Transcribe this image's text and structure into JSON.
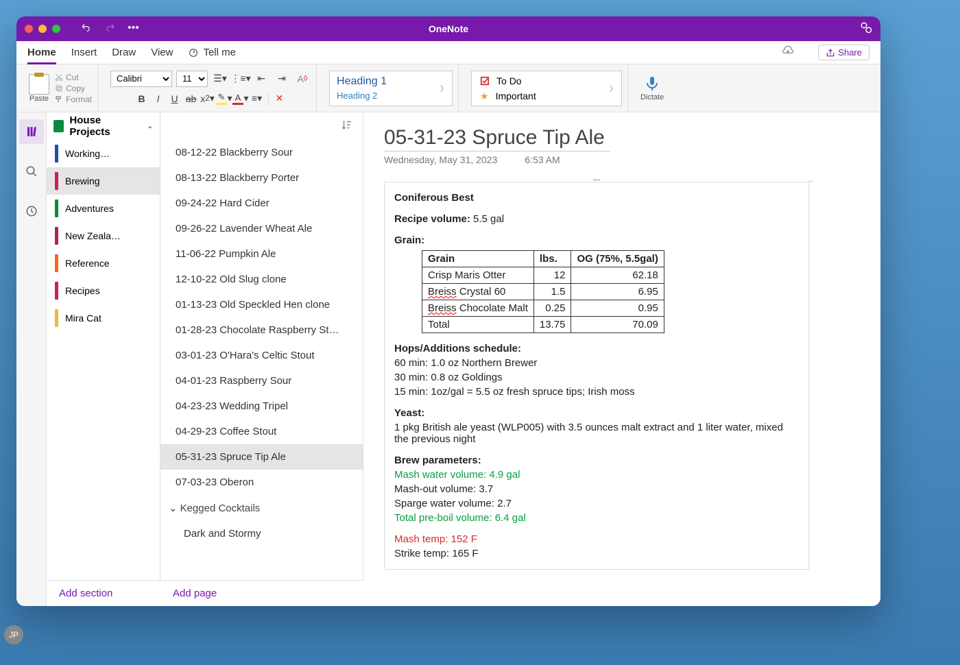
{
  "titlebar": {
    "title": "OneNote"
  },
  "tabs": {
    "home": "Home",
    "insert": "Insert",
    "draw": "Draw",
    "view": "View",
    "tellme": "Tell me",
    "share": "Share"
  },
  "ribbon": {
    "paste": "Paste",
    "cut": "Cut",
    "copy": "Copy",
    "format": "Format",
    "font": "Calibri",
    "size": "11",
    "heading1": "Heading 1",
    "heading2": "Heading 2",
    "todo": "To Do",
    "important": "Important",
    "dictate": "Dictate"
  },
  "notebook": {
    "name": "House Projects"
  },
  "sections": [
    {
      "label": "Working…",
      "color": "#1e4ea0"
    },
    {
      "label": "Brewing",
      "color": "#c81e5b",
      "selected": true
    },
    {
      "label": "Adventures",
      "color": "#0d8a3e"
    },
    {
      "label": "New Zeala…",
      "color": "#b51e4f"
    },
    {
      "label": "Reference",
      "color": "#ee6b1f"
    },
    {
      "label": "Recipes",
      "color": "#c81e5b"
    },
    {
      "label": "Mira Cat",
      "color": "#f0b93a"
    }
  ],
  "pages": [
    {
      "t": "08-12-22 Blackberry Sour"
    },
    {
      "t": "08-13-22 Blackberry Porter"
    },
    {
      "t": "09-24-22 Hard Cider"
    },
    {
      "t": "09-26-22 Lavender Wheat Ale"
    },
    {
      "t": "11-06-22 Pumpkin Ale"
    },
    {
      "t": "12-10-22 Old Slug clone"
    },
    {
      "t": "01-13-23 Old Speckled Hen clone"
    },
    {
      "t": "01-28-23 Chocolate Raspberry St…"
    },
    {
      "t": "03-01-23 O'Hara's Celtic Stout"
    },
    {
      "t": "04-01-23 Raspberry Sour"
    },
    {
      "t": "04-23-23 Wedding Tripel"
    },
    {
      "t": "04-29-23 Coffee Stout"
    },
    {
      "t": "05-31-23 Spruce Tip Ale",
      "sel": true
    },
    {
      "t": "07-03-23 Oberon"
    }
  ],
  "page_group": "Kegged Cocktails",
  "page_sub": "Dark and Stormy",
  "footer": {
    "add_section": "Add section",
    "add_page": "Add page"
  },
  "avatar": "JP",
  "note": {
    "title": "05-31-23 Spruce Tip Ale",
    "date": "Wednesday, May 31, 2023",
    "time": "6:53 AM",
    "h": "Coniferous Best",
    "recipe_vol_lbl": "Recipe volume:",
    "recipe_vol": " 5.5 gal",
    "grain_lbl": "Grain:",
    "table": {
      "h1": "Grain",
      "h2": "lbs.",
      "h3": "OG (75%, 5.5gal)",
      "r1a": "Crisp Maris Otter",
      "r1b": "12",
      "r1c": "62.18",
      "r2a": "Breiss",
      "r2a2": " Crystal 60",
      "r2b": "1.5",
      "r2c": "6.95",
      "r3a": "Breiss",
      "r3a2": " Chocolate Malt",
      "r3b": "0.25",
      "r3c": "0.95",
      "r4a": "Total",
      "r4b": "13.75",
      "r4c": "70.09"
    },
    "hops_lbl": "Hops/Additions schedule:",
    "hop1": "60 min: 1.0 oz Northern Brewer",
    "hop2": "30 min: 0.8 oz Goldings",
    "hop3": "15 min: 1oz/gal = 5.5 oz fresh spruce tips; Irish moss",
    "yeast_lbl": "Yeast:",
    "yeast": "1 pkg British ale yeast (WLP005) with 3.5 ounces malt extract and 1 liter water, mixed the previous night",
    "brew_lbl": "Brew parameters:",
    "mash_water": "Mash water volume: 4.9 gal",
    "mash_out": "Mash-out volume: 3.7",
    "sparge": "Sparge water volume: 2.7",
    "preboil": "Total pre-boil volume: 6.4 gal",
    "mash_temp": "Mash temp: 152 F",
    "strike": "Strike temp:  165 F"
  }
}
